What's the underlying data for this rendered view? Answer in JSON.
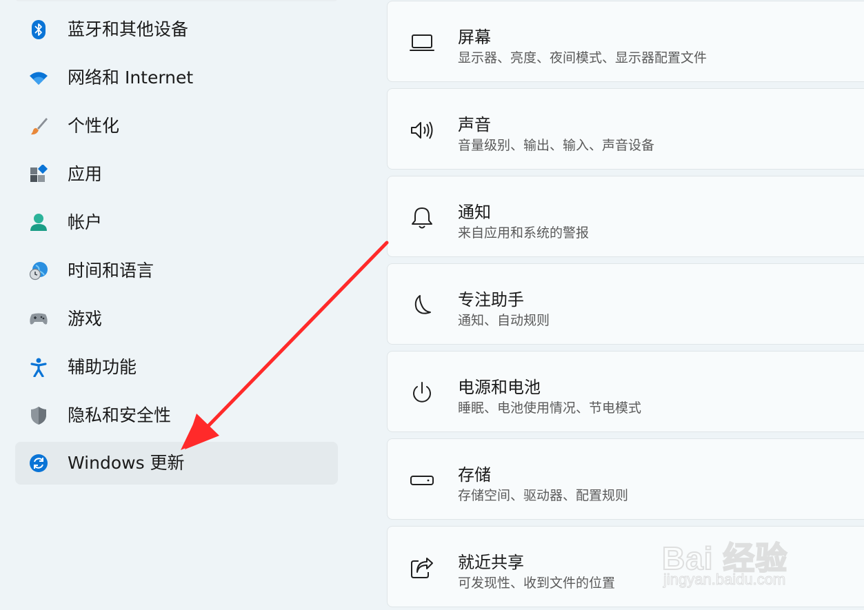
{
  "sidebar": {
    "items": [
      {
        "label": "蓝牙和其他设备",
        "icon": "bluetooth-icon"
      },
      {
        "label": "网络和 Internet",
        "icon": "wifi-icon"
      },
      {
        "label": "个性化",
        "icon": "brush-icon"
      },
      {
        "label": "应用",
        "icon": "apps-icon"
      },
      {
        "label": "帐户",
        "icon": "account-icon"
      },
      {
        "label": "时间和语言",
        "icon": "globe-clock-icon"
      },
      {
        "label": "游戏",
        "icon": "gamepad-icon"
      },
      {
        "label": "辅助功能",
        "icon": "accessibility-icon"
      },
      {
        "label": "隐私和安全性",
        "icon": "shield-icon"
      },
      {
        "label": "Windows 更新",
        "icon": "sync-icon",
        "selected": true
      }
    ]
  },
  "main": {
    "cards": [
      {
        "title": "屏幕",
        "subtitle": "显示器、亮度、夜间模式、显示器配置文件",
        "icon": "laptop-icon"
      },
      {
        "title": "声音",
        "subtitle": "音量级别、输出、输入、声音设备",
        "icon": "speaker-icon"
      },
      {
        "title": "通知",
        "subtitle": "来自应用和系统的警报",
        "icon": "bell-icon"
      },
      {
        "title": "专注助手",
        "subtitle": "通知、自动规则",
        "icon": "moon-icon"
      },
      {
        "title": "电源和电池",
        "subtitle": "睡眠、电池使用情况、节电模式",
        "icon": "power-icon"
      },
      {
        "title": "存储",
        "subtitle": "存储空间、驱动器、配置规则",
        "icon": "storage-icon"
      },
      {
        "title": "就近共享",
        "subtitle": "可发现性、收到文件的位置",
        "icon": "share-icon"
      }
    ]
  },
  "watermark": {
    "logo": "Bai 经验",
    "url": "jingyan.baidu.com"
  },
  "colors": {
    "accent": "#0067c0",
    "arrow": "#ff2a2a"
  }
}
